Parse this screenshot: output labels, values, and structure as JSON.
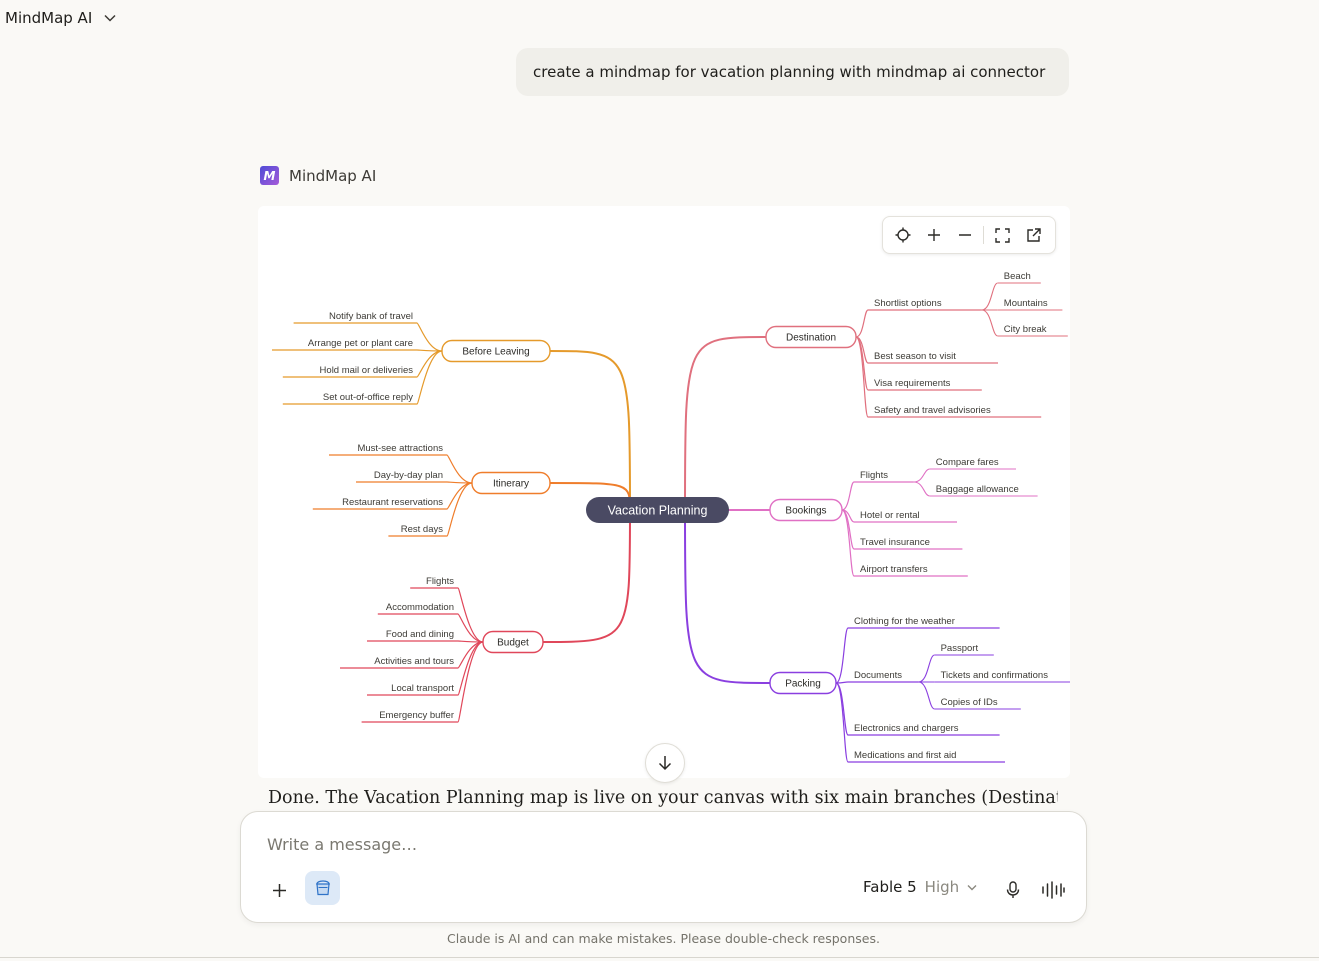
{
  "app": {
    "title": "MindMap AI"
  },
  "user_message": "create a mindmap for vacation planning with mindmap ai connector",
  "tool": {
    "name": "MindMap AI",
    "logo_letter": "M"
  },
  "mindmap": {
    "root": "Vacation Planning",
    "branches": [
      {
        "label": "Before Leaving",
        "side": "left",
        "color": "#e59a2b",
        "children": [
          {
            "label": "Notify bank of travel"
          },
          {
            "label": "Arrange pet or plant care"
          },
          {
            "label": "Hold mail or deliveries"
          },
          {
            "label": "Set out-of-office reply"
          }
        ]
      },
      {
        "label": "Itinerary",
        "side": "left",
        "color": "#ef7d2b",
        "children": [
          {
            "label": "Must-see attractions"
          },
          {
            "label": "Day-by-day plan"
          },
          {
            "label": "Restaurant reservations"
          },
          {
            "label": "Rest days"
          }
        ]
      },
      {
        "label": "Budget",
        "side": "left",
        "color": "#e0475a",
        "children": [
          {
            "label": "Flights"
          },
          {
            "label": "Accommodation"
          },
          {
            "label": "Food and dining"
          },
          {
            "label": "Activities and tours"
          },
          {
            "label": "Local transport"
          },
          {
            "label": "Emergency buffer"
          }
        ]
      },
      {
        "label": "Destination",
        "side": "right",
        "color": "#e0707e",
        "children": [
          {
            "label": "Shortlist options",
            "children": [
              {
                "label": "Beach"
              },
              {
                "label": "Mountains"
              },
              {
                "label": "City break"
              }
            ]
          },
          {
            "label": "Best season to visit"
          },
          {
            "label": "Visa requirements"
          },
          {
            "label": "Safety and travel advisories"
          }
        ]
      },
      {
        "label": "Bookings",
        "side": "right",
        "color": "#e070c4",
        "children": [
          {
            "label": "Flights",
            "children": [
              {
                "label": "Compare fares"
              },
              {
                "label": "Baggage allowance"
              }
            ]
          },
          {
            "label": "Hotel or rental"
          },
          {
            "label": "Travel insurance"
          },
          {
            "label": "Airport transfers"
          }
        ]
      },
      {
        "label": "Packing",
        "side": "right",
        "color": "#8a3fe0",
        "children": [
          {
            "label": "Clothing for the weather"
          },
          {
            "label": "Documents",
            "children": [
              {
                "label": "Passport"
              },
              {
                "label": "Tickets and confirmations"
              },
              {
                "label": "Copies of IDs"
              }
            ]
          },
          {
            "label": "Electronics and chargers"
          },
          {
            "label": "Medications and first aid"
          }
        ]
      }
    ]
  },
  "map_toolbar": {
    "icons": [
      "recenter-icon",
      "zoom-in-icon",
      "zoom-out-icon",
      "fullscreen-icon",
      "open-external-icon"
    ]
  },
  "assistant_text": "Done. The Vacation Planning map is live on your canvas with six main branches (Destination,",
  "composer": {
    "placeholder": "Write a message…",
    "model": "Fable 5",
    "effort": "High"
  },
  "disclaimer": "Claude is AI and can make mistakes. Please double-check responses."
}
